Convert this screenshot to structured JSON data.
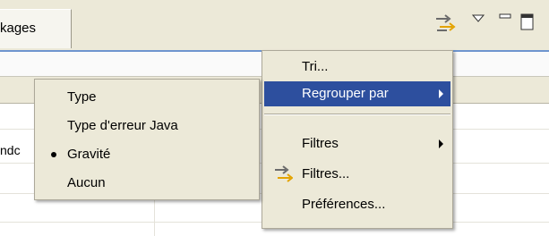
{
  "tab": {
    "label": "kages"
  },
  "view_icons": [
    "sync-icon",
    "view-menu-icon",
    "minimize-icon",
    "maximize-icon"
  ],
  "table": {
    "partial_text": "ndc"
  },
  "context_menu": {
    "items": [
      {
        "label": "Tri...",
        "has_submenu": false
      },
      {
        "label": "Regrouper par",
        "has_submenu": true,
        "selected": true
      },
      {
        "label": "Filtres",
        "has_submenu": true
      },
      {
        "label": "Filtres...",
        "icon": "filter-icon"
      },
      {
        "label": "Préférences..."
      }
    ]
  },
  "submenu": {
    "items": [
      {
        "label": "Type",
        "checked": false
      },
      {
        "label": "Type d'erreur Java",
        "checked": false
      },
      {
        "label": "Gravité",
        "checked": true
      },
      {
        "label": "Aucun",
        "checked": false
      }
    ]
  },
  "colors": {
    "menu_bg": "#ece9d8",
    "highlight": "#2d4f9e",
    "accent_line": "#6e95cf"
  }
}
